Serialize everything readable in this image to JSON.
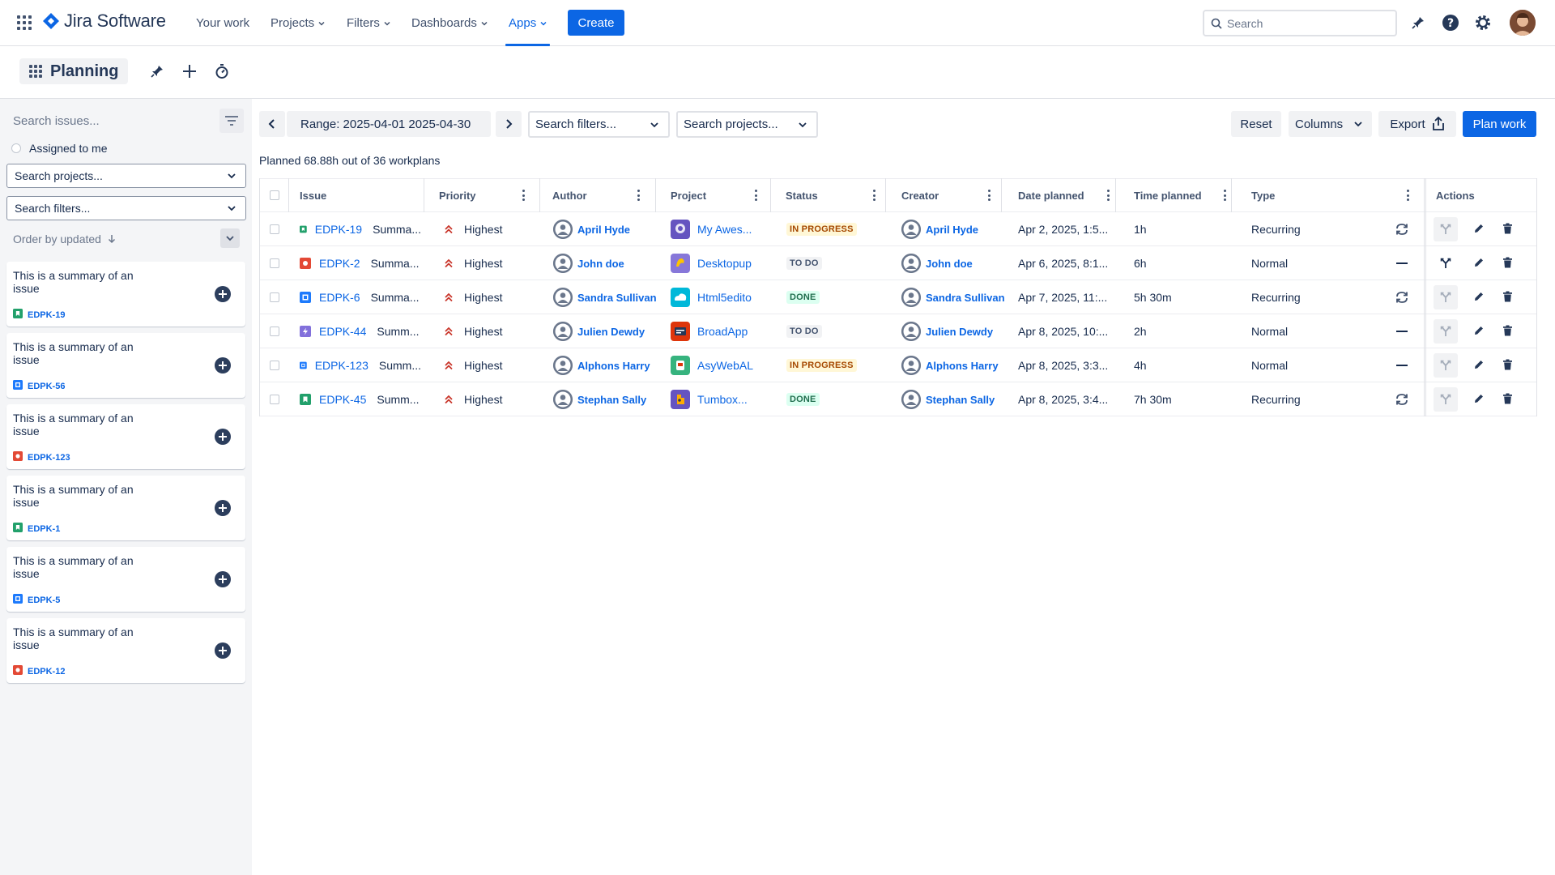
{
  "nav": {
    "product": "Jira Software",
    "items": [
      {
        "label": "Your work",
        "dropdown": false,
        "active": false
      },
      {
        "label": "Projects",
        "dropdown": true,
        "active": false
      },
      {
        "label": "Filters",
        "dropdown": true,
        "active": false
      },
      {
        "label": "Dashboards",
        "dropdown": true,
        "active": false
      },
      {
        "label": "Apps",
        "dropdown": true,
        "active": true
      }
    ],
    "create_label": "Create",
    "search_placeholder": "Search"
  },
  "subheader": {
    "title": "Planning"
  },
  "sidebar": {
    "search_placeholder": "Search issues...",
    "assigned_label": "Assigned to me",
    "projects_placeholder": "Search projects...",
    "filters_placeholder": "Search filters...",
    "order_label": "Order by updated",
    "cards": [
      {
        "summary": "This is a summary of an issue",
        "key": "EDPK-19",
        "type": "story"
      },
      {
        "summary": "This is a summary of an issue",
        "key": "EDPK-56",
        "type": "task"
      },
      {
        "summary": "This is a summary of an issue",
        "key": "EDPK-123",
        "type": "bug"
      },
      {
        "summary": "This is a summary of an issue",
        "key": "EDPK-1",
        "type": "story"
      },
      {
        "summary": "This is a summary of an issue",
        "key": "EDPK-5",
        "type": "task"
      },
      {
        "summary": "This is a summary of an issue",
        "key": "EDPK-12",
        "type": "bug"
      }
    ]
  },
  "toolbar": {
    "range_label": "Range: 2025-04-01 2025-04-30",
    "filters_placeholder": "Search filters...",
    "projects_placeholder": "Search projects...",
    "reset_label": "Reset",
    "columns_label": "Columns",
    "export_label": "Export",
    "plan_label": "Plan work"
  },
  "planned_summary": "Planned 68.88h out of 36 workplans",
  "table": {
    "columns": [
      "Issue",
      "Priority",
      "Author",
      "Project",
      "Status",
      "Creator",
      "Date planned",
      "Time planned",
      "Type",
      "Actions"
    ],
    "rows": [
      {
        "key": "EDPK-19",
        "summary": "Summa...",
        "type_icon": "story",
        "priority": "Highest",
        "author": "April Hyde",
        "project": "My Awes...",
        "project_color": "#6554c0",
        "status": "IN PROGRESS",
        "status_kind": "inprogress",
        "creator": "April Hyde",
        "date": "Apr 2, 2025, 1:5...",
        "time": "1h",
        "plan_type": "Recurring",
        "recurring": true,
        "split_enabled": false
      },
      {
        "key": "EDPK-2",
        "summary": "Summa...",
        "type_icon": "bug",
        "priority": "Highest",
        "author": "John doe",
        "project": "Desktopup",
        "project_color": "#8777d9",
        "status": "TO DO",
        "status_kind": "todo",
        "creator": "John doe",
        "date": "Apr 6, 2025, 8:1...",
        "time": "6h",
        "plan_type": "Normal",
        "recurring": false,
        "split_enabled": true
      },
      {
        "key": "EDPK-6",
        "summary": "Summa...",
        "type_icon": "task",
        "priority": "Highest",
        "author": "Sandra Sullivan",
        "project": "Html5edito",
        "project_color": "#00b8d9",
        "status": "DONE",
        "status_kind": "done",
        "creator": "Sandra Sullivan",
        "date": "Apr 7, 2025, 11:...",
        "time": "5h 30m",
        "plan_type": "Recurring",
        "recurring": true,
        "split_enabled": false
      },
      {
        "key": "EDPK-44",
        "summary": "Summ...",
        "type_icon": "epic",
        "priority": "Highest",
        "author": "Julien Dewdy",
        "project": "BroadApp",
        "project_color": "#de350b",
        "status": "TO DO",
        "status_kind": "todo",
        "creator": "Julien Dewdy",
        "date": "Apr 8, 2025, 10:...",
        "time": "2h",
        "plan_type": "Normal",
        "recurring": false,
        "split_enabled": false
      },
      {
        "key": "EDPK-123",
        "summary": "Summ...",
        "type_icon": "task",
        "priority": "Highest",
        "author": "Alphons Harry",
        "project": "AsyWebAL",
        "project_color": "#36b37e",
        "status": "IN PROGRESS",
        "status_kind": "inprogress",
        "creator": "Alphons Harry",
        "date": "Apr 8, 2025, 3:3...",
        "time": "4h",
        "plan_type": "Normal",
        "recurring": false,
        "split_enabled": false
      },
      {
        "key": "EDPK-45",
        "summary": "Summ...",
        "type_icon": "story",
        "priority": "Highest",
        "author": "Stephan Sally",
        "project": "Tumbox...",
        "project_color": "#6554c0",
        "status": "DONE",
        "status_kind": "done",
        "creator": "Stephan Sally",
        "date": "Apr 8, 2025, 3:4...",
        "time": "7h 30m",
        "plan_type": "Recurring",
        "recurring": true,
        "split_enabled": false
      }
    ]
  },
  "colors": {
    "brand": "#0c66e4",
    "story": "#22a06b",
    "bug": "#e34935",
    "task": "#1d7afc",
    "epic": "#8270db",
    "priority_highest": "#c9372c"
  }
}
